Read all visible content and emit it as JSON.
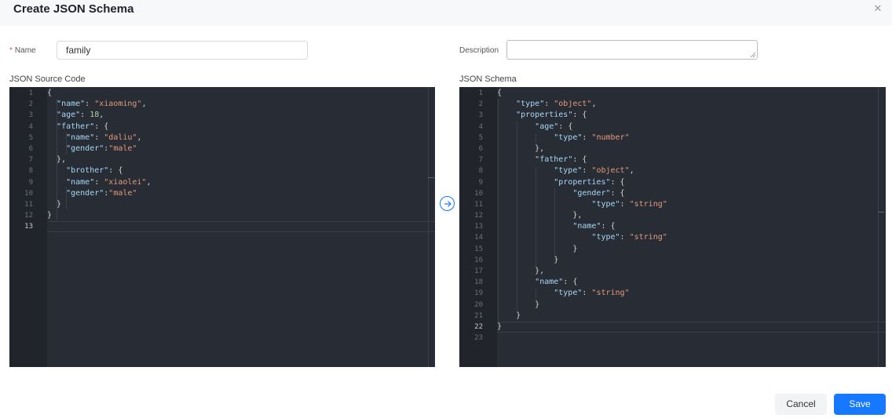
{
  "dialog": {
    "title": "Create JSON Schema"
  },
  "form": {
    "required_mark": "*",
    "name_label": "Name",
    "name_value": "family",
    "description_label": "Description",
    "description_value": ""
  },
  "source": {
    "label": "JSON Source Code",
    "active_line": 13,
    "lines": [
      [
        {
          "t": "p",
          "v": "{"
        }
      ],
      [
        {
          "t": "p",
          "v": "  "
        },
        {
          "t": "key",
          "v": "\"name\""
        },
        {
          "t": "p",
          "v": ": "
        },
        {
          "t": "s",
          "v": "\"xiaoming\""
        },
        {
          "t": "p",
          "v": ","
        }
      ],
      [
        {
          "t": "p",
          "v": "  "
        },
        {
          "t": "key",
          "v": "\"age\""
        },
        {
          "t": "p",
          "v": ": "
        },
        {
          "t": "n",
          "v": "18"
        },
        {
          "t": "p",
          "v": ","
        }
      ],
      [
        {
          "t": "p",
          "v": "  "
        },
        {
          "t": "key",
          "v": "\"father\""
        },
        {
          "t": "p",
          "v": ": {"
        }
      ],
      [
        {
          "t": "p",
          "v": "    "
        },
        {
          "t": "key",
          "v": "\"name\""
        },
        {
          "t": "p",
          "v": ": "
        },
        {
          "t": "s",
          "v": "\"daliu\""
        },
        {
          "t": "p",
          "v": ","
        }
      ],
      [
        {
          "t": "p",
          "v": "    "
        },
        {
          "t": "key",
          "v": "\"gender\""
        },
        {
          "t": "p",
          "v": ":"
        },
        {
          "t": "s",
          "v": "\"male\""
        }
      ],
      [
        {
          "t": "p",
          "v": "  },"
        }
      ],
      [
        {
          "t": "p",
          "v": "    "
        },
        {
          "t": "key",
          "v": "\"brother\""
        },
        {
          "t": "p",
          "v": ": {"
        }
      ],
      [
        {
          "t": "p",
          "v": "    "
        },
        {
          "t": "key",
          "v": "\"name\""
        },
        {
          "t": "p",
          "v": ": "
        },
        {
          "t": "s",
          "v": "\"xiaolei\""
        },
        {
          "t": "p",
          "v": ","
        }
      ],
      [
        {
          "t": "p",
          "v": "    "
        },
        {
          "t": "key",
          "v": "\"gender\""
        },
        {
          "t": "p",
          "v": ":"
        },
        {
          "t": "s",
          "v": "\"male\""
        }
      ],
      [
        {
          "t": "p",
          "v": "  }"
        }
      ],
      [
        {
          "t": "p",
          "v": "}"
        }
      ],
      []
    ]
  },
  "schema": {
    "label": "JSON Schema",
    "active_line": 22,
    "lines": [
      [
        {
          "t": "p",
          "v": "{"
        }
      ],
      [
        {
          "t": "p",
          "v": "    "
        },
        {
          "t": "key",
          "v": "\"type\""
        },
        {
          "t": "p",
          "v": ": "
        },
        {
          "t": "s",
          "v": "\"object\""
        },
        {
          "t": "p",
          "v": ","
        }
      ],
      [
        {
          "t": "p",
          "v": "    "
        },
        {
          "t": "key",
          "v": "\"properties\""
        },
        {
          "t": "p",
          "v": ": {"
        }
      ],
      [
        {
          "t": "p",
          "v": "        "
        },
        {
          "t": "key",
          "v": "\"age\""
        },
        {
          "t": "p",
          "v": ": {"
        }
      ],
      [
        {
          "t": "p",
          "v": "            "
        },
        {
          "t": "key",
          "v": "\"type\""
        },
        {
          "t": "p",
          "v": ": "
        },
        {
          "t": "s",
          "v": "\"number\""
        }
      ],
      [
        {
          "t": "p",
          "v": "        },"
        }
      ],
      [
        {
          "t": "p",
          "v": "        "
        },
        {
          "t": "key",
          "v": "\"father\""
        },
        {
          "t": "p",
          "v": ": {"
        }
      ],
      [
        {
          "t": "p",
          "v": "            "
        },
        {
          "t": "key",
          "v": "\"type\""
        },
        {
          "t": "p",
          "v": ": "
        },
        {
          "t": "s",
          "v": "\"object\""
        },
        {
          "t": "p",
          "v": ","
        }
      ],
      [
        {
          "t": "p",
          "v": "            "
        },
        {
          "t": "key",
          "v": "\"properties\""
        },
        {
          "t": "p",
          "v": ": {"
        }
      ],
      [
        {
          "t": "p",
          "v": "                "
        },
        {
          "t": "key",
          "v": "\"gender\""
        },
        {
          "t": "p",
          "v": ": {"
        }
      ],
      [
        {
          "t": "p",
          "v": "                    "
        },
        {
          "t": "key",
          "v": "\"type\""
        },
        {
          "t": "p",
          "v": ": "
        },
        {
          "t": "s",
          "v": "\"string\""
        }
      ],
      [
        {
          "t": "p",
          "v": "                },"
        }
      ],
      [
        {
          "t": "p",
          "v": "                "
        },
        {
          "t": "key",
          "v": "\"name\""
        },
        {
          "t": "p",
          "v": ": {"
        }
      ],
      [
        {
          "t": "p",
          "v": "                    "
        },
        {
          "t": "key",
          "v": "\"type\""
        },
        {
          "t": "p",
          "v": ": "
        },
        {
          "t": "s",
          "v": "\"string\""
        }
      ],
      [
        {
          "t": "p",
          "v": "                }"
        }
      ],
      [
        {
          "t": "p",
          "v": "            }"
        }
      ],
      [
        {
          "t": "p",
          "v": "        },"
        }
      ],
      [
        {
          "t": "p",
          "v": "        "
        },
        {
          "t": "key",
          "v": "\"name\""
        },
        {
          "t": "p",
          "v": ": {"
        }
      ],
      [
        {
          "t": "p",
          "v": "            "
        },
        {
          "t": "key",
          "v": "\"type\""
        },
        {
          "t": "p",
          "v": ": "
        },
        {
          "t": "s",
          "v": "\"string\""
        }
      ],
      [
        {
          "t": "p",
          "v": "        }"
        }
      ],
      [
        {
          "t": "p",
          "v": "    }"
        }
      ],
      [
        {
          "t": "p",
          "v": "}"
        }
      ],
      []
    ]
  },
  "convert_icon": "arrow-right-circle-icon",
  "close_icon": "close-icon",
  "buttons": {
    "cancel": "Cancel",
    "save": "Save"
  },
  "colors": {
    "primary": "#1677ff",
    "required": "#e34d59",
    "editor_bg": "#282c34",
    "json_key": "#a6d9f7",
    "json_string": "#e49a7c",
    "json_number": "#b5cea8"
  }
}
